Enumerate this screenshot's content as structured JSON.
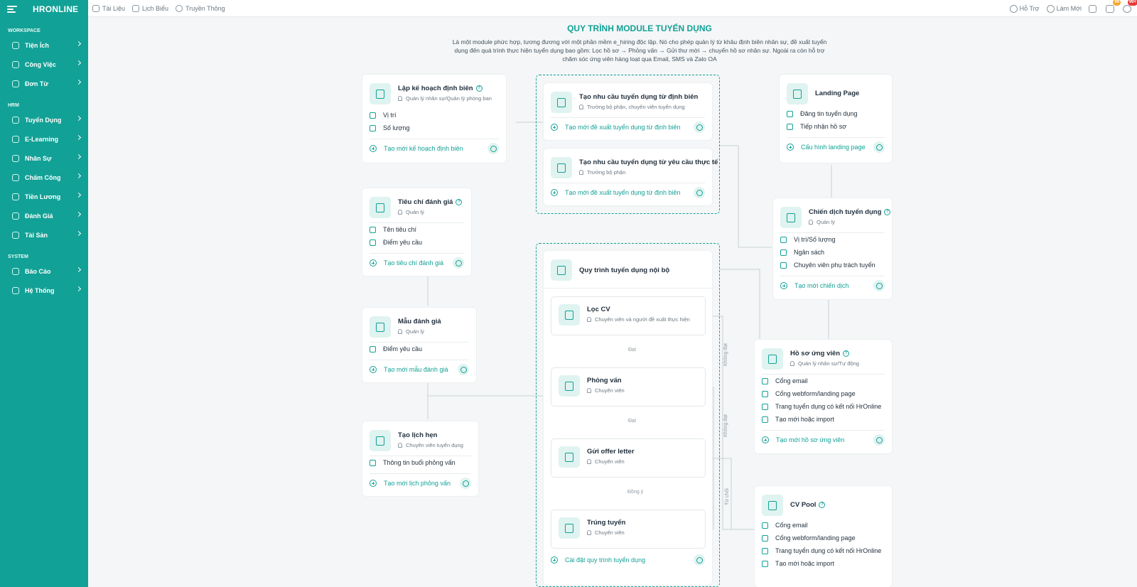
{
  "sidebar": {
    "logo": "HRONLINE",
    "sections": [
      {
        "label": "WORKSPACE",
        "items": [
          "Tiện Ích",
          "Công Việc",
          "Đơn Từ"
        ]
      },
      {
        "label": "HRM",
        "items": [
          "Tuyển Dụng",
          "E-Learning",
          "Nhân Sự",
          "Chấm Công",
          "Tiền Lương",
          "Đánh Giá",
          "Tài Sản"
        ]
      },
      {
        "label": "SYSTEM",
        "items": [
          "Báo Cáo",
          "Hệ Thống"
        ]
      }
    ]
  },
  "topbar": {
    "links": [
      "Tài Liệu",
      "Lịch Biểu",
      "Truyền Thông"
    ],
    "support": "Hỗ Trợ",
    "refresh": "Làm Mới",
    "msg_badge": "99",
    "notif_badge": "99+"
  },
  "page": {
    "title": "QUY TRÌNH MODULE TUYỂN DỤNG",
    "desc": "Là một module phức hợp, tương đương với một phần mềm e_hiring độc lập. Nó cho phép quản lý từ khâu định biên nhân sự, đề xuất tuyển dụng đến quá trình thực hiện tuyển dụng bao gồm: Lọc hồ sơ → Phỏng vấn → Gửi thư mời → chuyển hồ sơ nhân sự. Ngoài ra còn hỗ trợ chăm sóc ứng viên hàng loạt qua Email, SMS và Zalo OA"
  },
  "cards": {
    "plan": {
      "title": "Lập kế hoạch định biên",
      "sub": "Quản lý nhân sự/Quản lý phòng ban",
      "rows": [
        "Vị trí",
        "Số lượng"
      ],
      "action": "Tạo mới kế hoạch định biên"
    },
    "criteria": {
      "title": "Tiêu chí đánh giá",
      "sub": "Quản lý",
      "rows": [
        "Tên tiêu chí",
        "Điểm yêu cầu"
      ],
      "action": "Tạo tiêu chí đánh giá"
    },
    "template": {
      "title": "Mẫu đánh giá",
      "sub": "Quản lý",
      "rows": [
        "Điểm yêu cầu"
      ],
      "action": "Tạo mới mẫu đánh giá"
    },
    "schedule": {
      "title": "Tạo lịch hẹn",
      "sub": "Chuyên viên tuyển dụng",
      "rows": [
        "Thông tin buổi phỏng vấn"
      ],
      "action": "Tạo mới lịch phỏng vấn"
    },
    "need1": {
      "title": "Tạo nhu cầu tuyển dụng từ định biên",
      "sub": "Trưởng bộ phận, chuyên viên tuyển dụng",
      "action": "Tạo mới đề xuất tuyển dụng từ định biên"
    },
    "need2": {
      "title": "Tạo nhu cầu tuyển dụng từ yêu cầu thực tế",
      "sub": "Trưởng bộ phận",
      "action": "Tạo mới đề xuất tuyển dụng từ định biên"
    },
    "internal": {
      "title": "Quy trình tuyển dụng nội bộ",
      "action": "Cài đặt quy trình tuyển dụng"
    },
    "landing": {
      "title": "Landing Page",
      "rows": [
        "Đăng tin tuyển dụng",
        "Tiếp nhận hồ sơ"
      ],
      "action": "Cấu hình landing page"
    },
    "campaign": {
      "title": "Chiến dịch tuyển dụng",
      "sub": "Quản lý",
      "rows": [
        "Vị trí/Số lượng",
        "Ngân sách",
        "Chuyên viên phụ trách tuyển"
      ],
      "action": "Tạo mới chiến dịch"
    },
    "profile": {
      "title": "Hồ sơ ứng viên",
      "sub": "Quản lý nhân sự/Tự động",
      "rows": [
        "Cổng email",
        "Cổng webform/landing page",
        "Trang tuyển dụng có kết nối HrOnline",
        "Tạo mới hoặc import"
      ],
      "action": "Tạo mới hồ sơ ứng viên"
    },
    "pool": {
      "title": "CV Pool",
      "rows": [
        "Cổng email",
        "Cổng webform/landing page",
        "Trang tuyển dụng có kết nối HrOnline",
        "Tạo mới hoặc import"
      ]
    }
  },
  "stages": [
    {
      "title": "Lọc CV",
      "sub": "Chuyên viên và người đề xuất thực hiện"
    },
    {
      "title": "Phỏng vấn",
      "sub": "Chuyên viên"
    },
    {
      "title": "Gửi offer letter",
      "sub": "Chuyên viên"
    },
    {
      "title": "Trúng tuyển",
      "sub": "Chuyên viên"
    }
  ],
  "flow_labels": {
    "pass1": "Đạt",
    "pass2": "Đạt",
    "agree": "Đồng ý",
    "fail1": "Không đạt",
    "fail2": "Không đạt",
    "reject": "Từ chối"
  },
  "colors": {
    "primary": "#12a196",
    "icon_bg": "#dff3f0"
  }
}
